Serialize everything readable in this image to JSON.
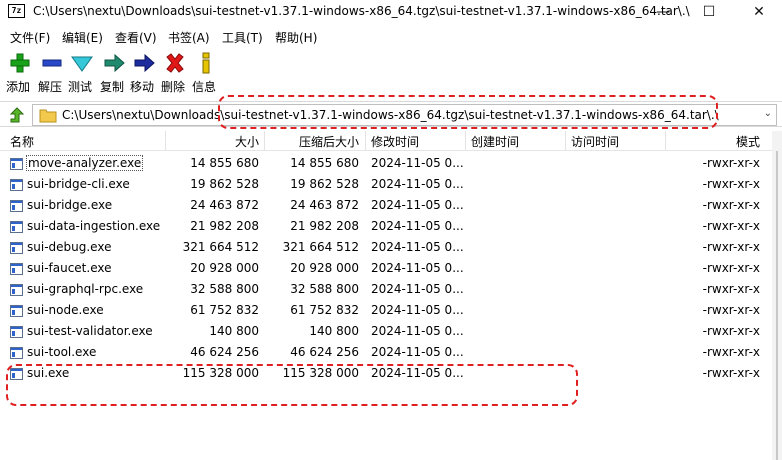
{
  "window": {
    "title": "C:\\Users\\nextu\\Downloads\\sui-testnet-v1.37.1-windows-x86_64.tgz\\sui-testnet-v1.37.1-windows-x86_64.tar\\.\\",
    "app_icon_text": "7z",
    "minimize": "—",
    "maximize": "☐",
    "close": "✕"
  },
  "menu": [
    "文件(F)",
    "编辑(E)",
    "查看(V)",
    "书签(A)",
    "工具(T)",
    "帮助(H)"
  ],
  "toolbar": [
    {
      "label": "添加",
      "icon": "add-icon"
    },
    {
      "label": "解压",
      "icon": "extract-icon"
    },
    {
      "label": "测试",
      "icon": "test-icon"
    },
    {
      "label": "复制",
      "icon": "copy-icon"
    },
    {
      "label": "移动",
      "icon": "move-icon"
    },
    {
      "label": "删除",
      "icon": "delete-icon"
    },
    {
      "label": "信息",
      "icon": "info-icon"
    }
  ],
  "address": {
    "path": "C:\\Users\\nextu\\Downloads\\sui-testnet-v1.37.1-windows-x86_64.tgz\\sui-testnet-v1.37.1-windows-x86_64.tar\\.\\"
  },
  "columns": [
    "名称",
    "大小",
    "压缩后大小",
    "修改时间",
    "创建时间",
    "访问时间",
    "模式"
  ],
  "files": [
    {
      "name": "move-analyzer.exe",
      "size": "14 855 680",
      "packed": "14 855 680",
      "modified": "2024-11-05 0...",
      "mode": "-rwxr-xr-x"
    },
    {
      "name": "sui-bridge-cli.exe",
      "size": "19 862 528",
      "packed": "19 862 528",
      "modified": "2024-11-05 0...",
      "mode": "-rwxr-xr-x"
    },
    {
      "name": "sui-bridge.exe",
      "size": "24 463 872",
      "packed": "24 463 872",
      "modified": "2024-11-05 0...",
      "mode": "-rwxr-xr-x"
    },
    {
      "name": "sui-data-ingestion.exe",
      "size": "21 982 208",
      "packed": "21 982 208",
      "modified": "2024-11-05 0...",
      "mode": "-rwxr-xr-x"
    },
    {
      "name": "sui-debug.exe",
      "size": "321 664 512",
      "packed": "321 664 512",
      "modified": "2024-11-05 0...",
      "mode": "-rwxr-xr-x"
    },
    {
      "name": "sui-faucet.exe",
      "size": "20 928 000",
      "packed": "20 928 000",
      "modified": "2024-11-05 0...",
      "mode": "-rwxr-xr-x"
    },
    {
      "name": "sui-graphql-rpc.exe",
      "size": "32 588 800",
      "packed": "32 588 800",
      "modified": "2024-11-05 0...",
      "mode": "-rwxr-xr-x"
    },
    {
      "name": "sui-node.exe",
      "size": "61 752 832",
      "packed": "61 752 832",
      "modified": "2024-11-05 0...",
      "mode": "-rwxr-xr-x"
    },
    {
      "name": "sui-test-validator.exe",
      "size": "140 800",
      "packed": "140 800",
      "modified": "2024-11-05 0...",
      "mode": "-rwxr-xr-x"
    },
    {
      "name": "sui-tool.exe",
      "size": "46 624 256",
      "packed": "46 624 256",
      "modified": "2024-11-05 0...",
      "mode": "-rwxr-xr-x"
    },
    {
      "name": "sui.exe",
      "size": "115 328 000",
      "packed": "115 328 000",
      "modified": "2024-11-05 0...",
      "mode": "-rwxr-xr-x"
    }
  ],
  "colors": {
    "annotation": "#e02020",
    "accent": "#2f63c9"
  }
}
